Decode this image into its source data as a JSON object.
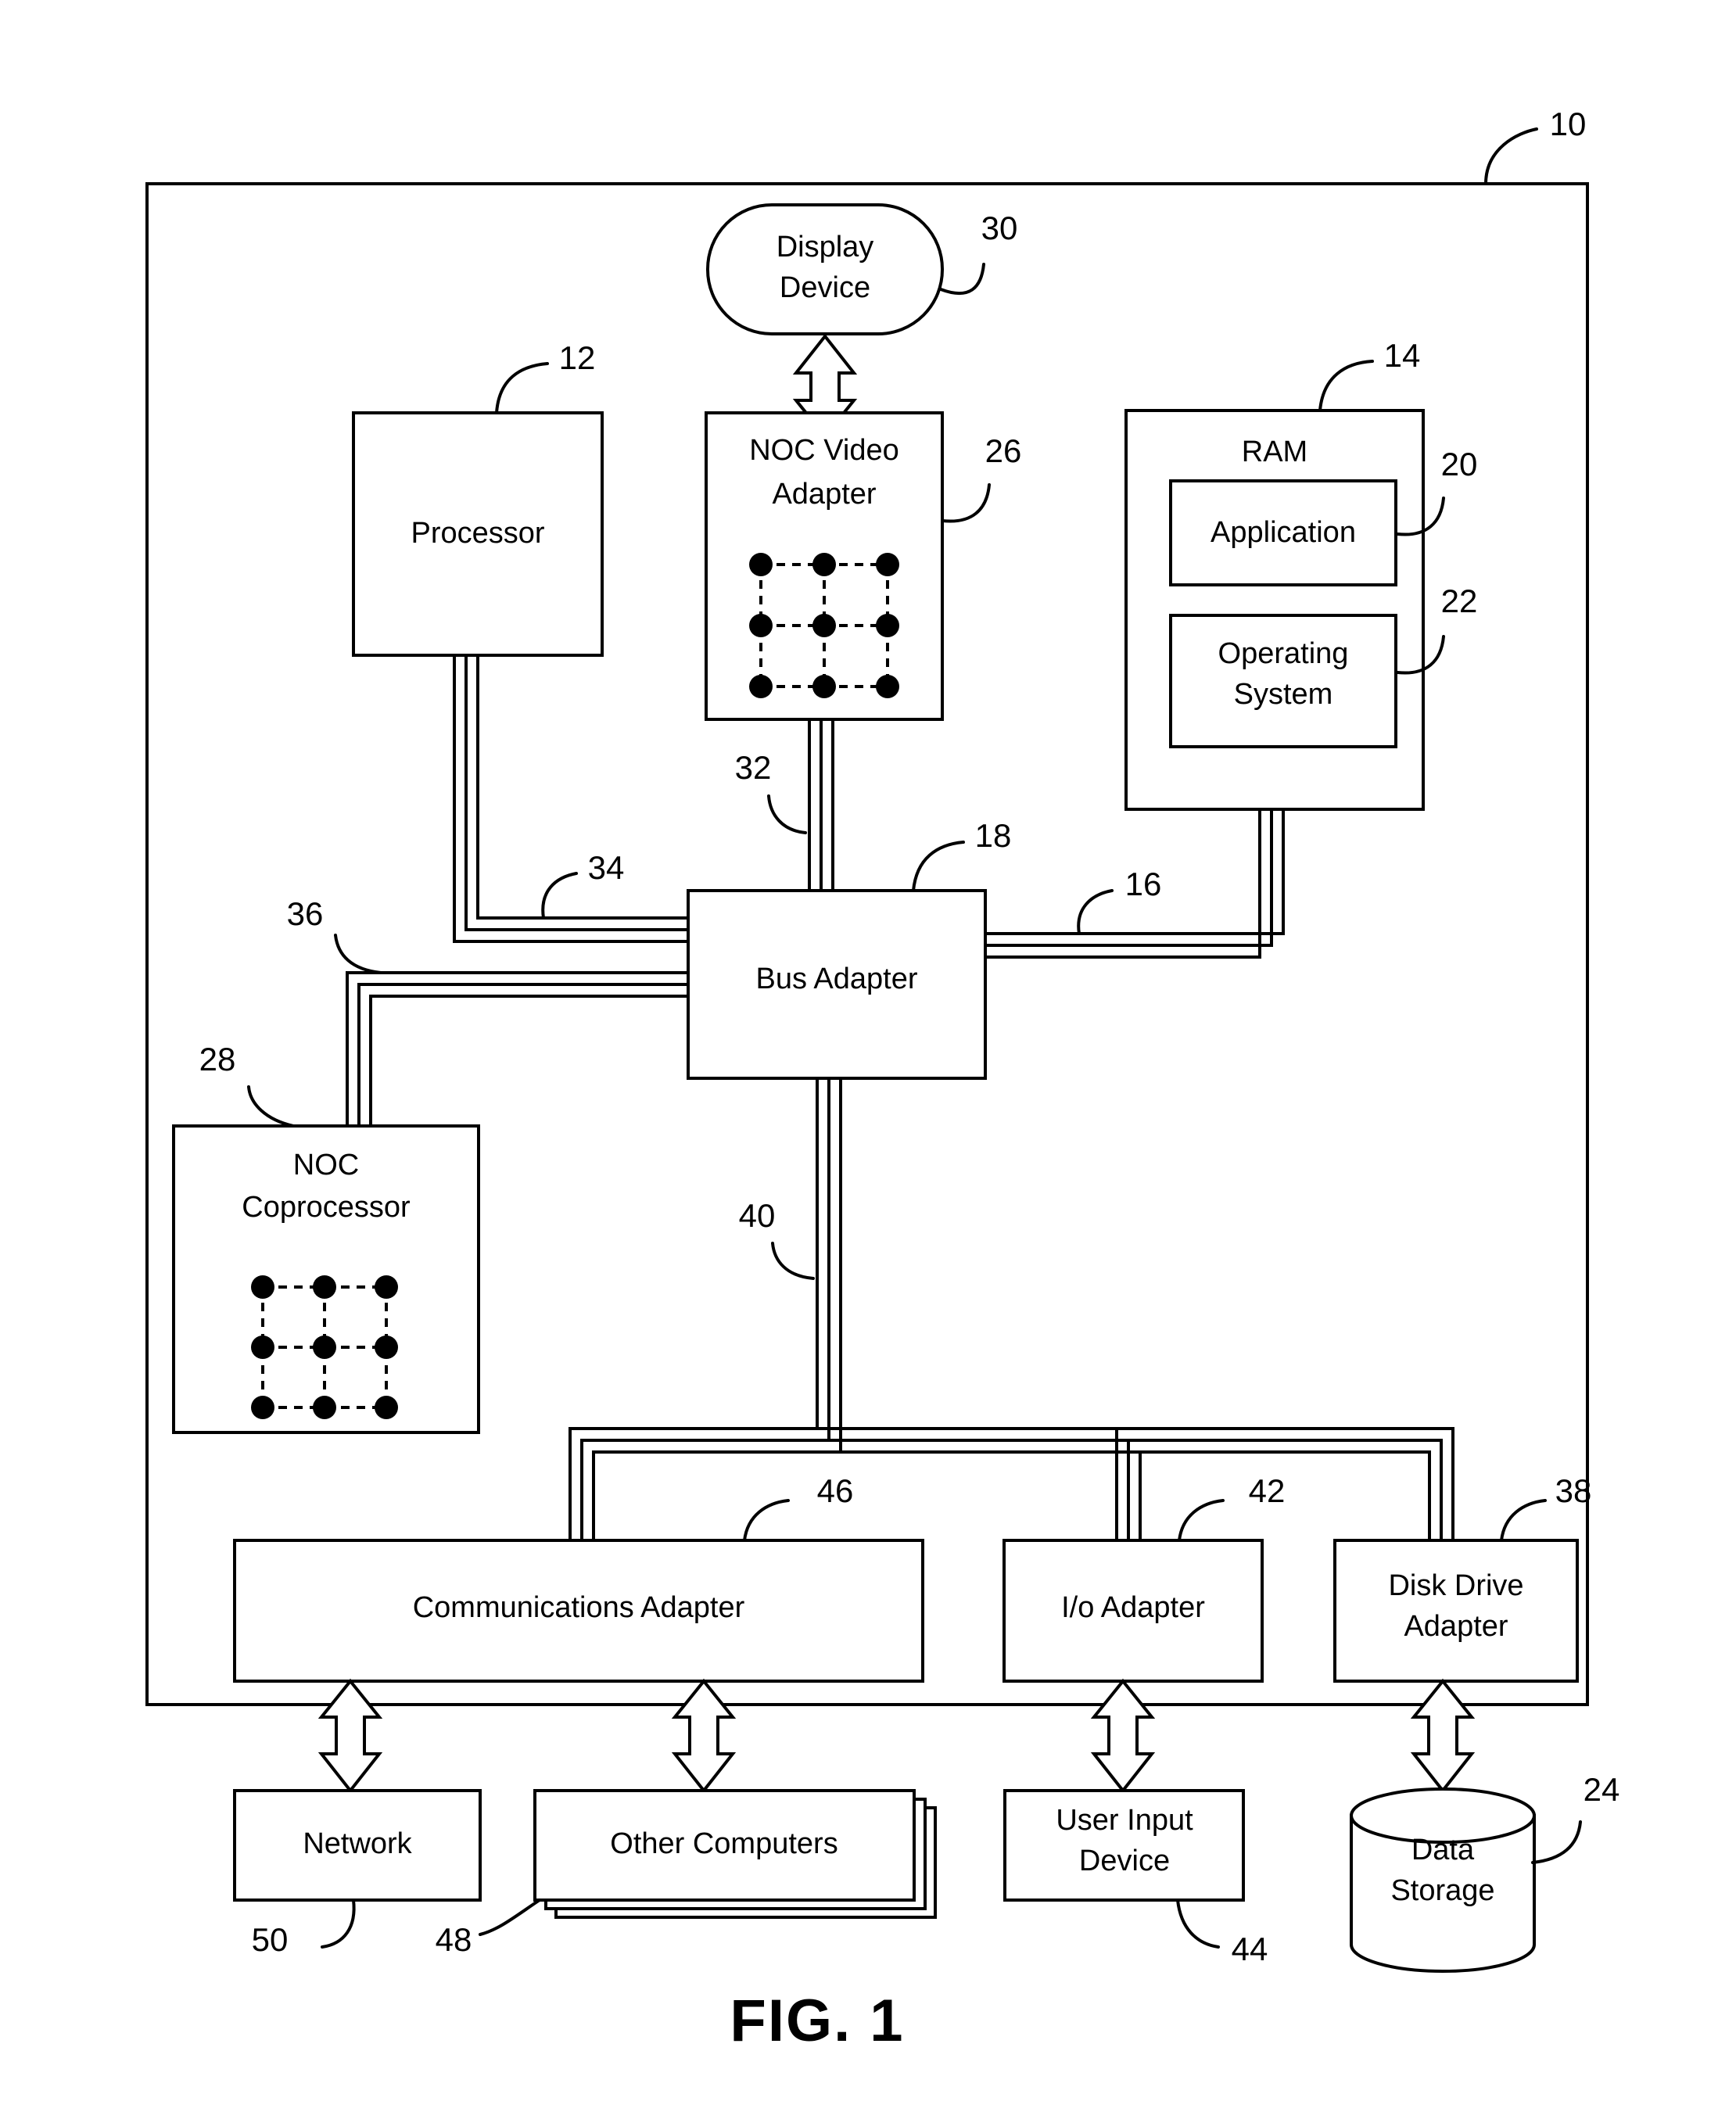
{
  "figure": {
    "caption": "FIG. 1",
    "outer_reference": "10"
  },
  "blocks": {
    "display_device": {
      "label_line1": "Display",
      "label_line2": "Device",
      "ref": "30"
    },
    "processor": {
      "label": "Processor",
      "ref": "12"
    },
    "noc_video_adapter": {
      "label_line1": "NOC Video",
      "label_line2": "Adapter",
      "ref": "26"
    },
    "ram": {
      "label": "RAM",
      "ref": "14"
    },
    "application": {
      "label": "Application",
      "ref": "20"
    },
    "operating_system": {
      "label_line1": "Operating",
      "label_line2": "System",
      "ref": "22"
    },
    "bus_adapter": {
      "label": "Bus Adapter",
      "ref": "18"
    },
    "noc_coprocessor": {
      "label_line1": "NOC",
      "label_line2": "Coprocessor",
      "ref": "28"
    },
    "communications_adapter": {
      "label": "Communications Adapter",
      "ref": "46"
    },
    "io_adapter": {
      "label": "I/o Adapter",
      "ref": "42"
    },
    "disk_drive_adapter": {
      "label_line1": "Disk Drive",
      "label_line2": "Adapter",
      "ref": "38"
    },
    "network": {
      "label": "Network",
      "ref": "50"
    },
    "other_computers": {
      "label": "Other Computers",
      "ref": "48"
    },
    "user_input_device": {
      "label_line1": "User Input",
      "label_line2": "Device",
      "ref": "44"
    },
    "data_storage": {
      "label_line1": "Data",
      "label_line2": "Storage",
      "ref": "24"
    }
  },
  "buses": {
    "video_bus": {
      "ref": "32"
    },
    "front_side_bus": {
      "ref": "34"
    },
    "coprocessor_bus": {
      "ref": "36"
    },
    "memory_bus": {
      "ref": "16"
    },
    "expansion_bus": {
      "ref": "40"
    }
  },
  "mesh": {
    "rows": 3,
    "cols": 3,
    "node_radius": 15
  },
  "colors": {
    "ink": "#000000",
    "paper": "#ffffff"
  }
}
